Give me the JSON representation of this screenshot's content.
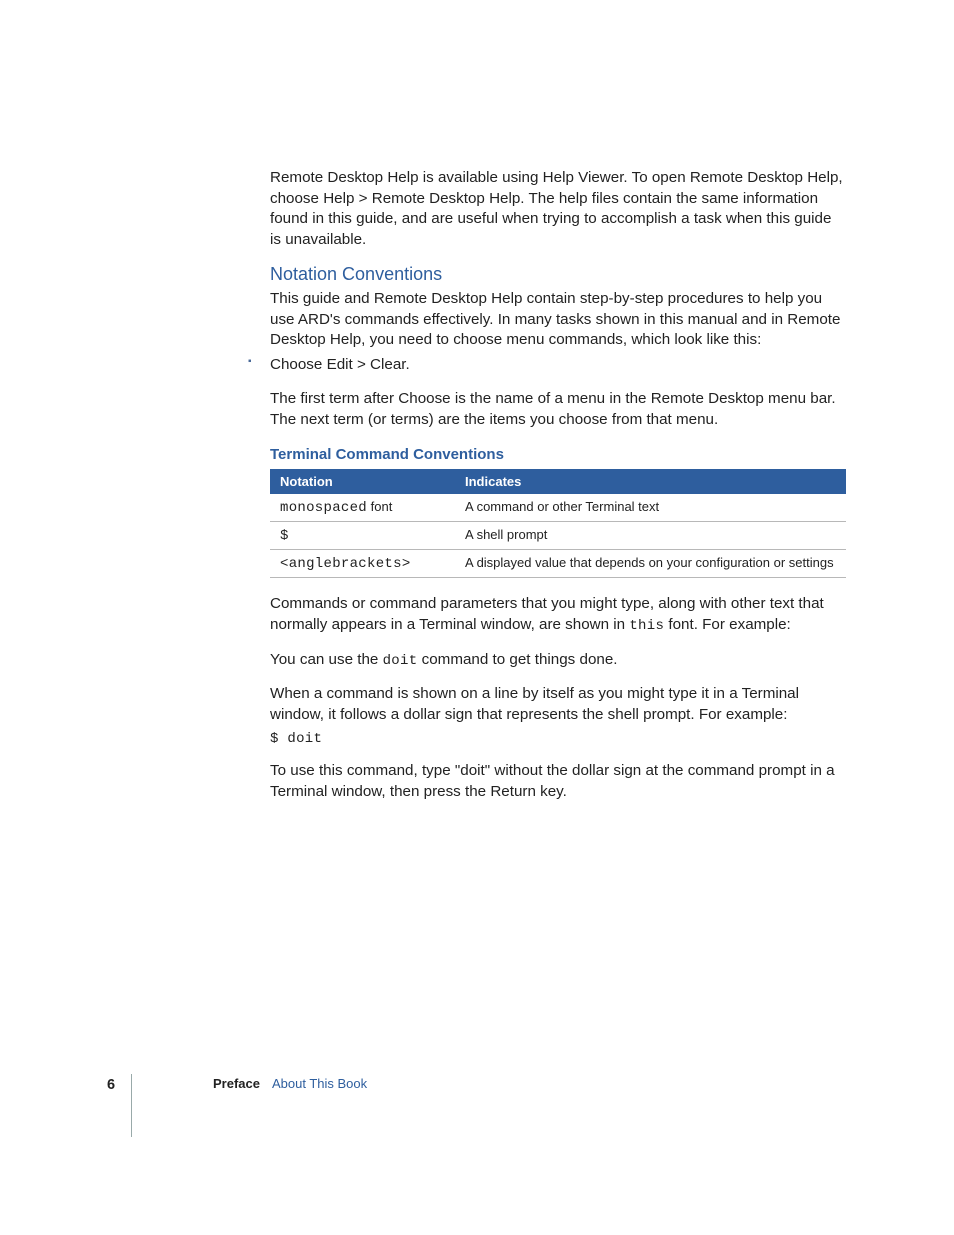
{
  "intro": "Remote Desktop Help is available using Help Viewer. To open Remote Desktop Help, choose Help > Remote Desktop Help. The help files contain the same information found in this guide, and are useful when trying to accomplish a task when this guide is unavailable.",
  "section": {
    "heading": "Notation Conventions",
    "para1": "This guide and Remote Desktop Help contain step-by-step procedures to help you use ARD's commands effectively. In many tasks shown in this manual and in Remote Desktop Help, you need to choose menu commands,  which look like this:",
    "bullet": "Choose Edit > Clear.",
    "para2": "The first term after Choose is the name of a menu in the Remote Desktop menu bar. The next term (or terms) are the items you choose from that menu."
  },
  "subheading": "Terminal Command Conventions",
  "table": {
    "headers": [
      "Notation",
      "Indicates"
    ],
    "rows": [
      {
        "notation_mono": "monospaced",
        "notation_tail": " font",
        "indicates": "A command or other Terminal text"
      },
      {
        "notation_mono": "$",
        "notation_tail": "",
        "indicates": "A shell prompt"
      },
      {
        "notation_mono": "<anglebrackets>",
        "notation_tail": "",
        "indicates": "A displayed value that depends on your configuration or settings"
      }
    ]
  },
  "after": {
    "p1a": "Commands or command parameters that you might type, along with other text that normally appears in a Terminal window, are shown in ",
    "p1_mono": "this",
    "p1b": " font. For example:",
    "p2a": "You can use the ",
    "p2_mono": "doit",
    "p2b": " command to get things done.",
    "p3": "When a command is shown on a line by itself as you might type it in a Terminal window, it follows a dollar sign that represents the shell prompt. For example:",
    "code": "$ doit",
    "p4": "To use this command, type \"doit\" without the dollar sign at the command prompt in a Terminal window, then press the Return key."
  },
  "footer": {
    "page": "6",
    "bold": "Preface",
    "blue": "About This Book"
  }
}
